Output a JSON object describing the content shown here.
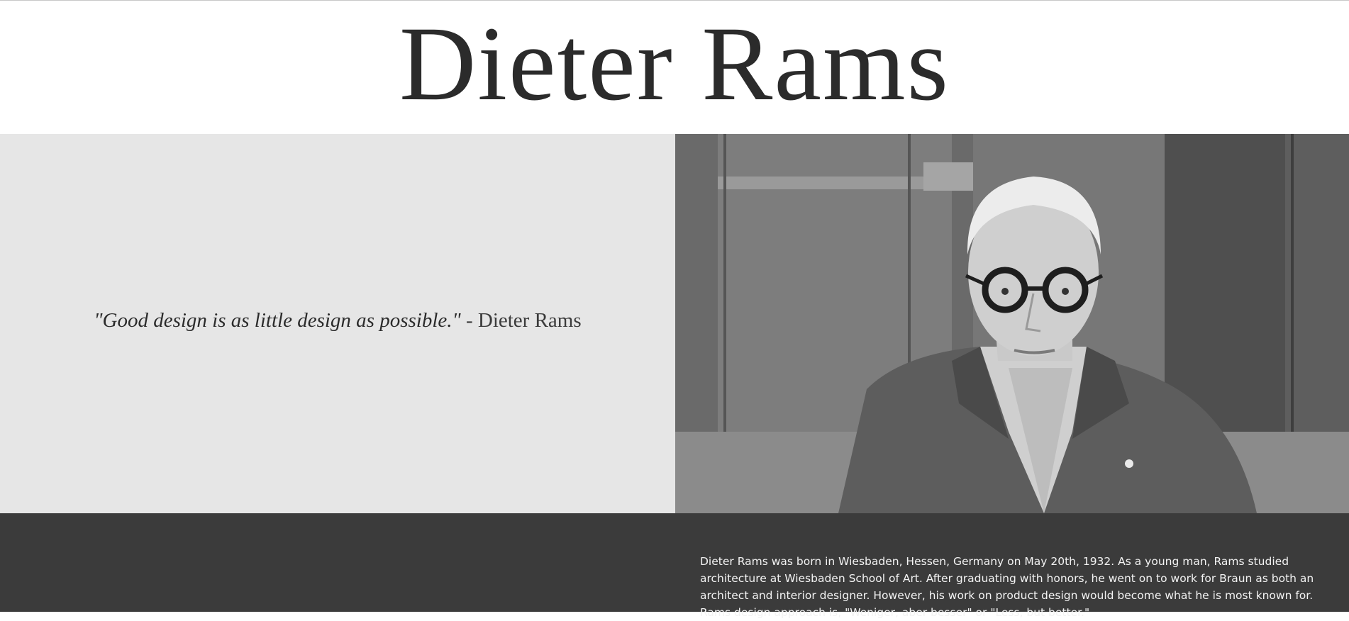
{
  "header": {
    "title": "Dieter Rams"
  },
  "hero": {
    "quote": "\"Good design is as little design as possible.\"",
    "quote_separator": " - ",
    "quote_author": "Dieter Rams",
    "photo_icon": "portrait-photo"
  },
  "bio": {
    "text": "Dieter Rams was born in Wiesbaden, Hessen, Germany on May 20th, 1932. As a young man, Rams studied architecture at Wiesbaden School of Art. After graduating with honors, he went on to work for Braun as both an architect and interior designer. However, his work on product design would become what he is most known for. Rams design approach is, \"Weniger, aber besser\" or \"Less, but better.\""
  },
  "colors": {
    "title": "#2b2b2b",
    "quote_panel_bg": "#e6e6e6",
    "bio_bg": "#3b3b3b",
    "bio_text": "#f3f3f3"
  }
}
